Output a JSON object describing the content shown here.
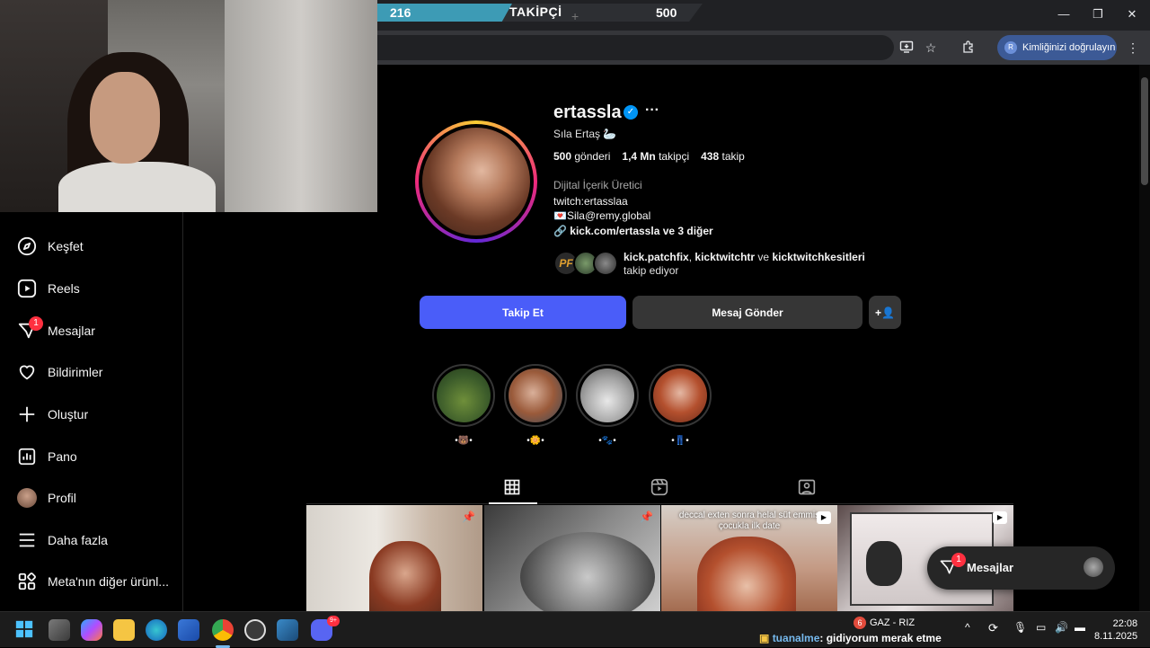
{
  "goal": {
    "current": "216",
    "label": "TAKİPÇİ",
    "target": "500",
    "progress": 0.43
  },
  "browser": {
    "verify_label": "Kimliğinizi doğrulayın",
    "verify_initial": "R"
  },
  "nav": {
    "items": [
      {
        "label": "Keşfet",
        "icon": "compass-icon"
      },
      {
        "label": "Reels",
        "icon": "reels-icon"
      },
      {
        "label": "Mesajlar",
        "icon": "messenger-icon",
        "badge": "1"
      },
      {
        "label": "Bildirimler",
        "icon": "heart-icon"
      },
      {
        "label": "Oluştur",
        "icon": "plus-icon"
      },
      {
        "label": "Pano",
        "icon": "dashboard-icon"
      },
      {
        "label": "Profil",
        "icon": "profile-avatar"
      },
      {
        "label": "Daha fazla",
        "icon": "menu-icon"
      },
      {
        "label": "Meta'nın diğer ürünl...",
        "icon": "meta-apps-icon"
      }
    ]
  },
  "profile": {
    "username": "ertassla",
    "full_name": "Sıla Ertaş 🦢",
    "posts_count": "500",
    "posts_label": "gönderi",
    "followers_count": "1,4 Mn",
    "followers_label": "takipçi",
    "following_count": "438",
    "following_label": "takip",
    "category": "Dijital İçerik Üretici",
    "bio_line1": "twitch:ertasslaa",
    "bio_line2": "💌Sila@remy.global",
    "link": "kick.com/ertassla ve 3 diğer",
    "followed_by_1": "kick.patchfix",
    "followed_by_sep": ",",
    "followed_by_2": "kicktwitchtr",
    "followed_by_and": "ve",
    "followed_by_3": "kicktwitchkesitleri",
    "followed_by_suffix": "takip ediyor",
    "pf_text": "PF"
  },
  "buttons": {
    "follow": "Takip Et",
    "message": "Mesaj Gönder",
    "suggest": "+👤"
  },
  "highlights": [
    {
      "label": "•🐻•"
    },
    {
      "label": "•🌼•"
    },
    {
      "label": "•🐾•"
    },
    {
      "label": "•👖•"
    }
  ],
  "posts": [
    {
      "type": "pinned"
    },
    {
      "type": "pinned"
    },
    {
      "type": "reel",
      "caption": "deccal exten sonra helal süt emmiş çocukla ilk date"
    },
    {
      "type": "reel"
    }
  ],
  "floating_messages": {
    "label": "Mesajlar",
    "badge": "1"
  },
  "taskbar": {
    "chat_user": "tuanalme",
    "chat_text": ": gidiyorum merak etme",
    "weather_badge": "6",
    "weather_text": "GAZ - RIZ",
    "discord_badge": "9+",
    "time": "22:08",
    "date": "8.11.2025"
  }
}
